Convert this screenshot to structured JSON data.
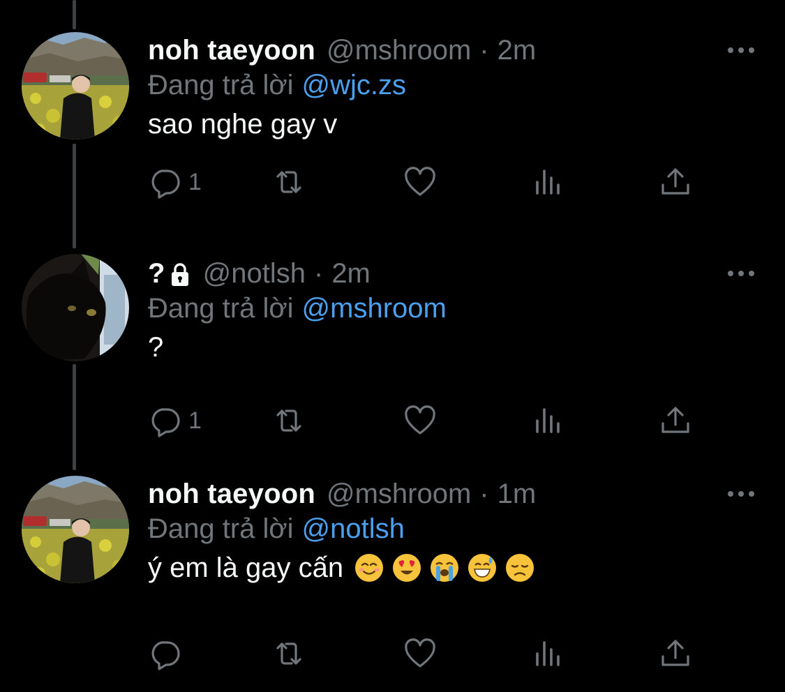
{
  "tweets": [
    {
      "display_name": "noh taeyoon",
      "handle": "@mshroom",
      "separator": "·",
      "time": "2m",
      "reply_label": "Đang trả lời",
      "reply_to": "@wjc.zs",
      "text": "sao nghe gay v",
      "reply_count": "1",
      "avatar": "person-photo",
      "locked": false
    },
    {
      "display_name": "?",
      "handle": "@notlsh",
      "separator": "·",
      "time": "2m",
      "reply_label": "Đang trả lời",
      "reply_to": "@mshroom",
      "text": "?",
      "reply_count": "1",
      "avatar": "cat-photo",
      "locked": true
    },
    {
      "display_name": "noh taeyoon",
      "handle": "@mshroom",
      "separator": "·",
      "time": "1m",
      "reply_label": "Đang trả lời",
      "reply_to": "@notlsh",
      "text": "ý em là gay cấn",
      "reply_count": "",
      "avatar": "person-photo",
      "locked": false,
      "emojis": [
        "smiling-face-emoji",
        "heart-eyes-emoji",
        "loudly-crying-emoji",
        "grinning-sweat-emoji",
        "disappointed-face-emoji"
      ]
    }
  ],
  "icons": [
    "reply-icon",
    "retweet-icon",
    "like-icon",
    "analytics-icon",
    "share-icon",
    "more-icon",
    "lock-icon"
  ],
  "colors": {
    "background": "#000000",
    "text_primary": "#f7f9f9",
    "text_secondary": "#71767b",
    "link": "#4a9fee",
    "thread_line": "#3d4144"
  }
}
